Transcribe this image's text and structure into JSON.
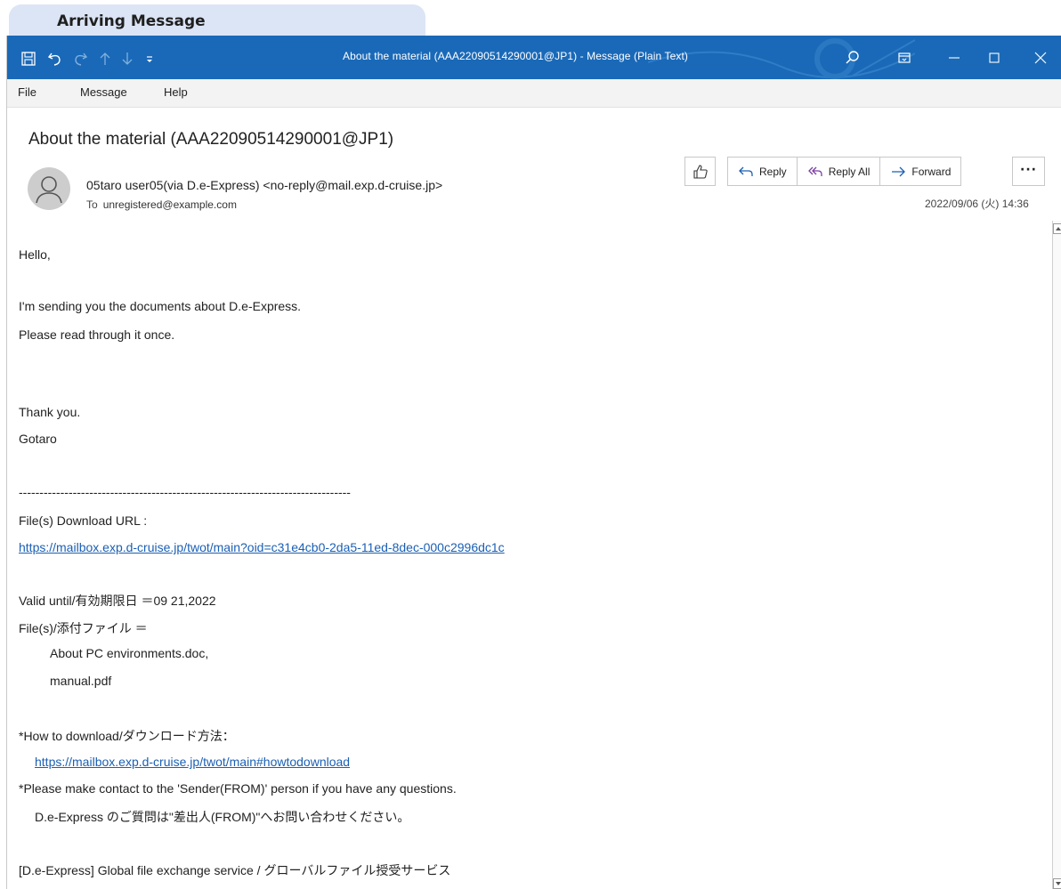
{
  "caption": "Arriving Message",
  "window": {
    "title": "About the material (AAA22090514290001@JP1)  -  Message (Plain Text)"
  },
  "icons": {
    "save": "save-icon",
    "undo": "undo-icon",
    "redo": "redo-icon",
    "up": "arrow-up-icon",
    "down": "arrow-down-icon",
    "customize": "customize-icon",
    "search": "search-icon",
    "ribbon": "ribbon-display-icon",
    "minimize": "minimize-icon",
    "maximize": "maximize-icon",
    "close": "close-icon"
  },
  "menu": [
    "File",
    "Message",
    "Help"
  ],
  "message": {
    "subject": "About the material (AAA22090514290001@JP1)",
    "from": "05taro user05(via D.e-Express) <no-reply@mail.exp.d-cruise.jp>",
    "to_label": "To",
    "to": "unregistered@example.com",
    "date": "2022/09/06 (火) 14:36"
  },
  "actions": {
    "reply": "Reply",
    "reply_all": "Reply All",
    "forward": "Forward",
    "more": "···"
  },
  "body": {
    "greeting": "Hello,",
    "line1": "I'm sending you the documents about D.e-Express.",
    "line2": "Please read through it once.",
    "thanks": "Thank you.",
    "signature": "Gotaro",
    "separator": "--------------------------------------------------------------------------------",
    "download_label": "File(s) Download URL :",
    "download_url": "https://mailbox.exp.d-cruise.jp/twot/main?oid=c31e4cb0-2da5-11ed-8dec-000c2996dc1c",
    "valid_until": "Valid until/有効期限日 ＝09 21,2022",
    "files_label": "File(s)/添付ファイル ＝",
    "file1": "About PC environments.doc,",
    "file2": "manual.pdf",
    "howto_label": "*How to download/ダウンロード方法：",
    "howto_url": "https://mailbox.exp.d-cruise.jp/twot/main#howtodownload",
    "contact_en": "*Please make contact to the 'Sender(FROM)' person if you have any questions.",
    "contact_jp": "D.e-Express のご質問は\"差出人(FROM)\"へお問い合わせください。",
    "footer": "[D.e-Express] Global file exchange service / グローバルファイル授受サービス"
  }
}
